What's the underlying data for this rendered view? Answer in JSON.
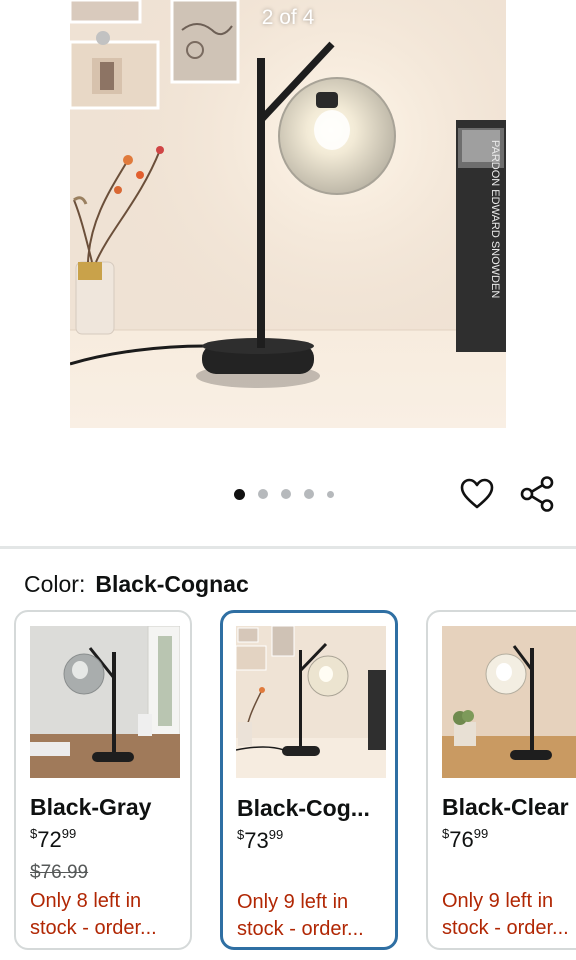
{
  "gallery": {
    "counter": "2 of 4",
    "book_spine_text": "PARDON EDWARD SNOWDEN",
    "dots_total": 5,
    "active_index": 0
  },
  "actions": {
    "favorite_icon": "heart-icon",
    "share_icon": "share-icon"
  },
  "color_selector": {
    "label": "Color:",
    "selected": "Black-Cognac"
  },
  "variants": [
    {
      "name": "Black-Gray",
      "price_symbol": "$",
      "price_whole": "72",
      "price_fraction": "99",
      "was_price": "$76.99",
      "stock_line1": "Only 8 left in",
      "stock_line2": "stock - order...",
      "selected": false
    },
    {
      "name": "Black-Cog...",
      "price_symbol": "$",
      "price_whole": "73",
      "price_fraction": "99",
      "was_price": "",
      "stock_line1": "Only 9 left in",
      "stock_line2": "stock - order...",
      "selected": true
    },
    {
      "name": "Black-Clear",
      "price_symbol": "$",
      "price_whole": "76",
      "price_fraction": "99",
      "was_price": "",
      "stock_line1": "Only 9 left in",
      "stock_line2": "stock - order...",
      "selected": false
    }
  ],
  "colors": {
    "stock_red": "#b12704",
    "selected_border": "#2f6fa3",
    "card_border": "#d5d9d9"
  }
}
